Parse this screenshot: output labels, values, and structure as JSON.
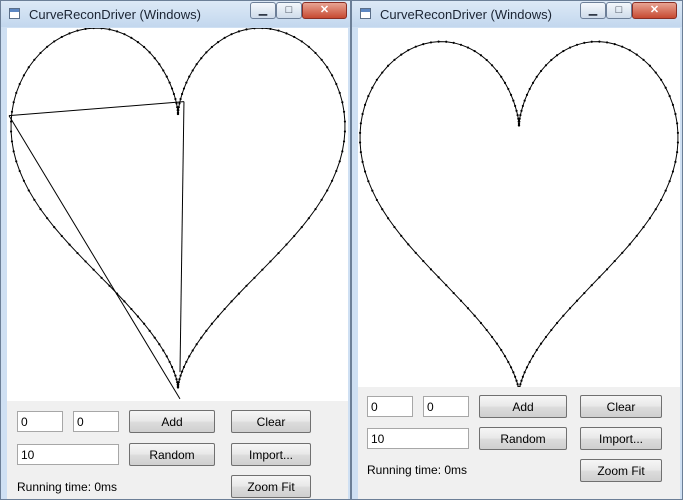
{
  "windows": [
    {
      "title": "CurveReconDriver (Windows)",
      "caption": {
        "minimize": "▁",
        "maximize": "□",
        "close": "✕"
      },
      "inputs": {
        "x_value": "0",
        "y_value": "0",
        "count_value": "10"
      },
      "buttons": {
        "add": "Add",
        "clear": "Clear",
        "random": "Random",
        "import": "Import...",
        "zoom_fit": "Zoom Fit"
      },
      "status": "Running time: 0ms"
    },
    {
      "title": "CurveReconDriver (Windows)",
      "caption": {
        "minimize": "▁",
        "maximize": "□",
        "close": "✕"
      },
      "inputs": {
        "x_value": "0",
        "y_value": "0",
        "count_value": "10"
      },
      "buttons": {
        "add": "Add",
        "clear": "Clear",
        "random": "Random",
        "import": "Import...",
        "zoom_fit": "Zoom Fit"
      },
      "status": "Running time: 0ms"
    }
  ],
  "colors": {
    "title_bar": "#cfe0f3",
    "close_button": "#c74a32",
    "curve": "#000000",
    "client_background": "#f0f0f0"
  }
}
